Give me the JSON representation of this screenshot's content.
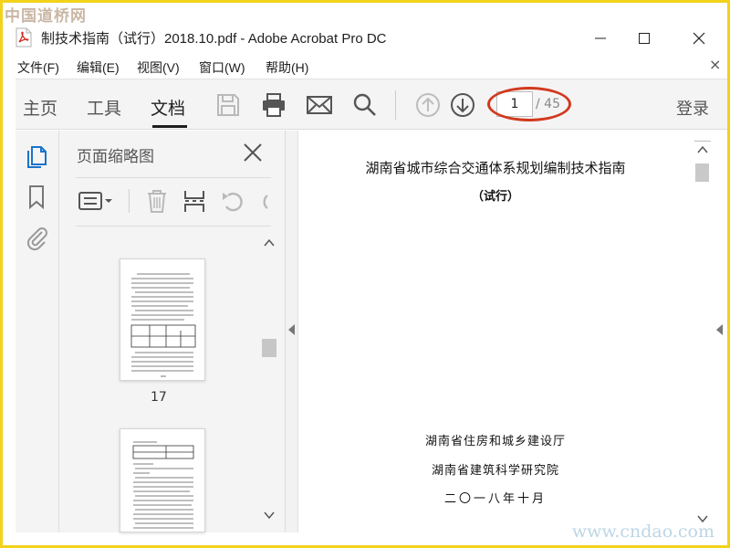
{
  "watermark": {
    "top": "中国道桥网",
    "bottom": "www.cndao.com"
  },
  "window": {
    "title": "制技术指南（试行）2018.10.pdf - Adobe Acrobat Pro DC"
  },
  "menu": {
    "items": [
      "文件(F)",
      "编辑(E)",
      "视图(V)",
      "窗口(W)",
      "帮助(H)"
    ],
    "close": "×"
  },
  "toolbar": {
    "tabs": [
      "主页",
      "工具",
      "文档"
    ],
    "active_tab": "文档",
    "page_current": "1",
    "page_total": "/ 45",
    "login": "登录",
    "icons": [
      "save-icon",
      "print-icon",
      "mail-icon",
      "search-icon",
      "page-up-icon",
      "page-down-icon"
    ]
  },
  "sidebar": {
    "icons": [
      "page-thumbnails-icon",
      "bookmark-icon",
      "attachment-icon"
    ]
  },
  "thumb_panel": {
    "title": "页面缩略图",
    "pages": [
      {
        "label": "17"
      },
      {
        "label": ""
      }
    ],
    "tools": [
      "options-icon",
      "delete-icon",
      "insert-icon",
      "rotate-ccw-icon",
      "rotate-cw-icon"
    ]
  },
  "document": {
    "title": "湖南省城市综合交通体系规划编制技术指南",
    "subtitle": "（试行）",
    "org1": "湖南省住房和城乡建设厅",
    "org2": "湖南省建筑科学研究院",
    "date": "二〇一八年十月"
  },
  "colors": {
    "highlight_ellipse": "#d2391e",
    "frame": "#f2d21a",
    "pdf_red": "#d7281e"
  }
}
